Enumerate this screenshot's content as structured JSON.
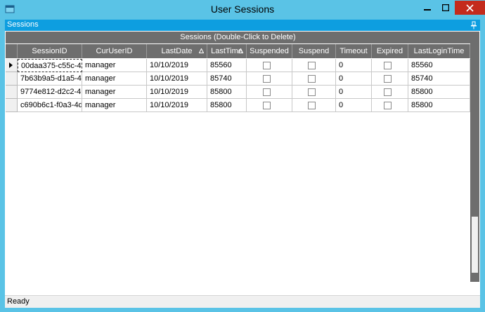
{
  "window": {
    "title": "User Sessions"
  },
  "panel": {
    "title": "Sessions"
  },
  "grid": {
    "caption": "Sessions (Double-Click to Delete)",
    "columns": [
      "SessionID",
      "CurUserID",
      "LastDate",
      "LastTime",
      "Suspended",
      "Suspend",
      "Timeout",
      "Expired",
      "LastLoginTime"
    ],
    "sorted_columns": [
      "LastDate",
      "LastTime"
    ],
    "rows": [
      {
        "SessionID": "00daa375-c55c-4",
        "CurUserID": "manager",
        "LastDate": "10/10/2019",
        "LastTime": "85560",
        "Suspended": false,
        "Suspend": false,
        "Timeout": "0",
        "Expired": false,
        "LastLoginTime": "85560"
      },
      {
        "SessionID": "7b63b9a5-d1a5-4",
        "CurUserID": "manager",
        "LastDate": "10/10/2019",
        "LastTime": "85740",
        "Suspended": false,
        "Suspend": false,
        "Timeout": "0",
        "Expired": false,
        "LastLoginTime": "85740"
      },
      {
        "SessionID": "9774e812-d2c2-4",
        "CurUserID": "manager",
        "LastDate": "10/10/2019",
        "LastTime": "85800",
        "Suspended": false,
        "Suspend": false,
        "Timeout": "0",
        "Expired": false,
        "LastLoginTime": "85800"
      },
      {
        "SessionID": "c690b6c1-f0a3-4d",
        "CurUserID": "manager",
        "LastDate": "10/10/2019",
        "LastTime": "85800",
        "Suspended": false,
        "Suspend": false,
        "Timeout": "0",
        "Expired": false,
        "LastLoginTime": "85800"
      }
    ]
  },
  "status": {
    "text": "Ready"
  },
  "colors": {
    "titlebar": "#5ac3e6",
    "panel_header": "#0d9ee0",
    "grid_header": "#6e6e6e",
    "close_button": "#c42b1c"
  },
  "icons": {
    "app": "window-app-icon",
    "pin": "pin-icon",
    "minimize": "minimize-icon",
    "maximize": "maximize-icon",
    "close": "close-icon"
  }
}
